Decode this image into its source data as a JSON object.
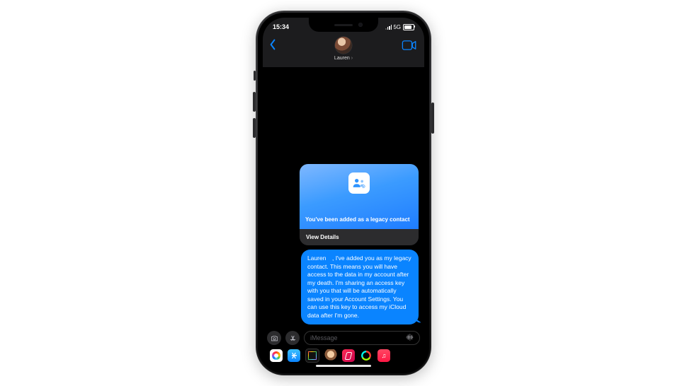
{
  "status": {
    "time": "15:34",
    "network": "5G"
  },
  "header": {
    "contact_name": "Lauren"
  },
  "card": {
    "title": "You've been added as a legacy contact",
    "action": "View Details"
  },
  "message": {
    "text": "Lauren , I've added you as my legacy contact. This means you will have access to the data in my account after my death. I'm sharing an access key with you that will be automatically saved in your Account Settings. You can use this key to access my iCloud data after I'm gone."
  },
  "input": {
    "placeholder": "iMessage"
  }
}
